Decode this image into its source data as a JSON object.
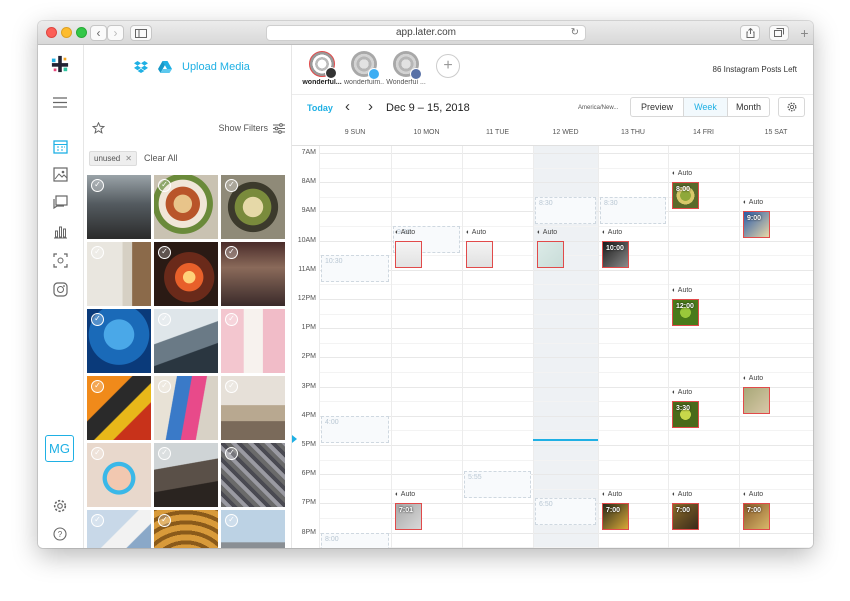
{
  "browser": {
    "url": "app.later.com",
    "colors": {
      "close": "#fc5f57",
      "minimize": "#fdbc2e",
      "zoom": "#33c748"
    }
  },
  "rail": {
    "logo_icon": "later-logo-icon",
    "items": [
      "menu-icon",
      "calendar-icon",
      "media-library-icon",
      "conversations-icon",
      "analytics-icon",
      "linkin-bio-icon",
      "instagram-icon"
    ],
    "user_initials": "MG",
    "bottom_items": [
      "settings-icon",
      "help-icon"
    ]
  },
  "media": {
    "upload_label": "Upload Media",
    "show_filters": "Show Filters",
    "filter_tag": "unused",
    "clear_all": "Clear All"
  },
  "calendar": {
    "accounts": [
      {
        "name": "wonderful...",
        "network": "instagram",
        "selected": true
      },
      {
        "name": "wonderfulm...",
        "network": "twitter",
        "selected": false
      },
      {
        "name": "Wonderful ...",
        "network": "facebook",
        "selected": false
      }
    ],
    "posts_left": "86 Instagram Posts Left",
    "today_label": "Today",
    "date_range": "Dec 9 – 15, 2018",
    "timezone": "America/New...",
    "preview_label": "Preview",
    "week_label": "Week",
    "month_label": "Month",
    "days": [
      "9 SUN",
      "10 MON",
      "11 TUE",
      "12 WED",
      "13 THU",
      "14 FRI",
      "15 SAT"
    ],
    "hours": [
      "7AM",
      "8AM",
      "9AM",
      "10AM",
      "11AM",
      "12PM",
      "1PM",
      "2PM",
      "3PM",
      "4PM",
      "5PM",
      "6PM",
      "7PM",
      "8PM"
    ],
    "auto_label": "Auto",
    "slot_times": [
      "10:30",
      "9:30",
      "8:30",
      "8:30",
      "4:00",
      "5:55",
      "6:50",
      "8:00"
    ],
    "post_times": [
      "8:00",
      "9:00",
      "10:00",
      "12:00",
      "3:30",
      "7:01",
      "7:00",
      "7:00",
      "7:00"
    ]
  },
  "accent_color": "#1fb0e4"
}
